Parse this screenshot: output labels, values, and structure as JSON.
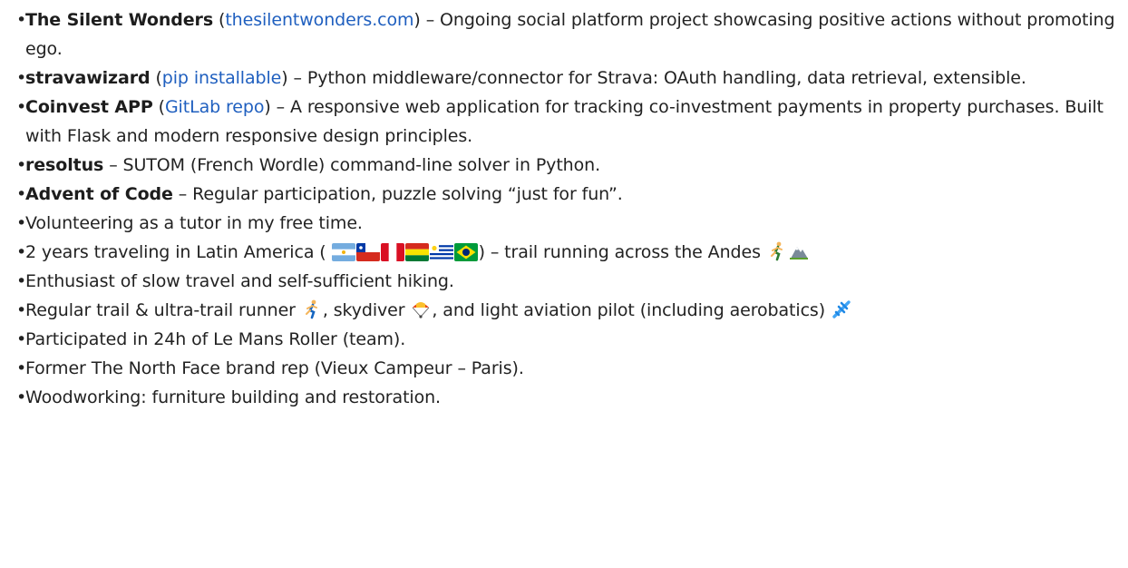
{
  "items": [
    {
      "title": "The Silent Wonders",
      "paren_open": " (",
      "link": "thesilentwonders.com",
      "paren_close": ")",
      "text": " – Ongoing social platform project showcasing positive actions without promoting ego."
    },
    {
      "title": "stravawizard",
      "paren_open": " (",
      "link": "pip installable",
      "paren_close": ")",
      "text": " – Python middleware/connector for Strava: OAuth handling, data retrieval, extensible."
    },
    {
      "title": "Coinvest APP",
      "paren_open": " (",
      "link": "GitLab repo",
      "paren_close": ")",
      "text": " – A responsive web application for tracking co-investment payments in property purchases. Built with Flask and modern responsive design principles."
    },
    {
      "title": "resoltus",
      "text": " – SUTOM (French Wordle) command-line solver in Python."
    },
    {
      "title": "Advent of Code",
      "text": " – Regular participation, puzzle solving “just for fun”."
    },
    {
      "text": "Volunteering as a tutor in my free time."
    },
    {
      "text_before": "2 years traveling in Latin America ( ",
      "text_after": ") – trail running across the Andes ",
      "flags": [
        "argentina-flag",
        "chile-flag",
        "peru-flag",
        "bolivia-flag",
        "uruguay-flag",
        "brazil-flag"
      ],
      "icons": [
        "runner-icon",
        "mountain-icon"
      ]
    },
    {
      "text": "Enthusiast of slow travel and self-sufficient hiking."
    },
    {
      "part1": "Regular trail & ultra-trail runner ",
      "part2": ", skydiver ",
      "part3": ", and light aviation pilot (including aerobatics) ",
      "icons": [
        "runner-icon",
        "parachute-icon",
        "airplane-icon"
      ]
    },
    {
      "text": "Participated in 24h of Le Mans Roller (team)."
    },
    {
      "text": "Former The North Face brand rep (Vieux Campeur – Paris)."
    },
    {
      "text": "Woodworking: furniture building and restoration."
    }
  ],
  "bullet": "•",
  "colors": {
    "text": "#222222",
    "link": "#1f5fbf"
  }
}
